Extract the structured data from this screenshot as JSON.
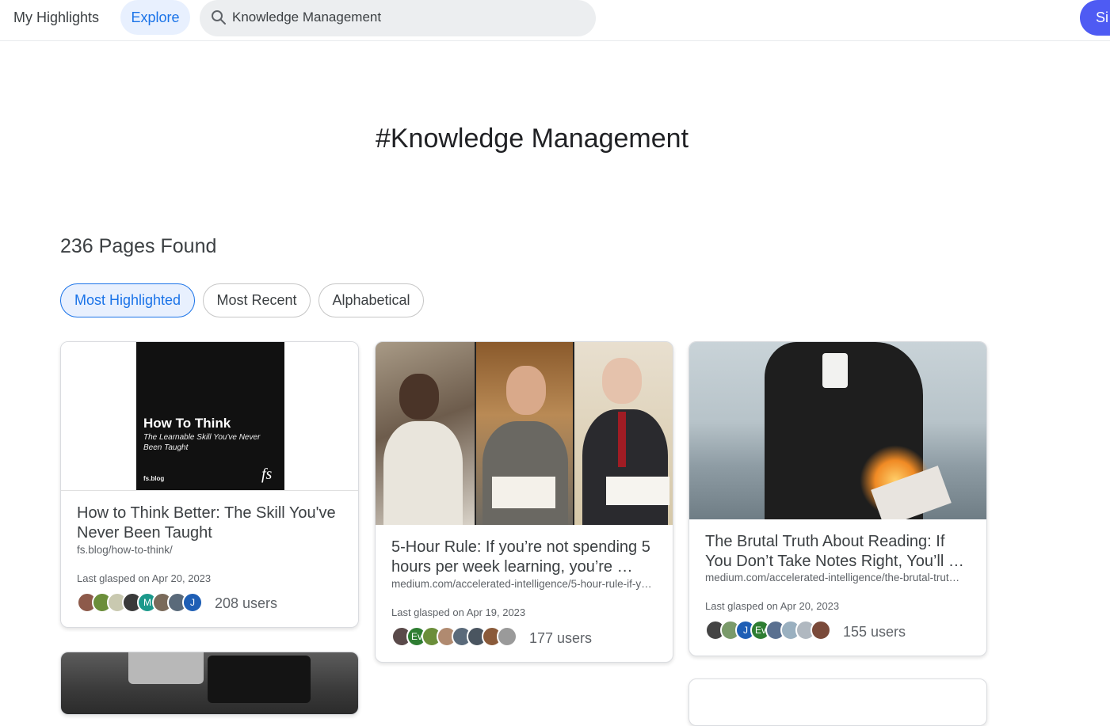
{
  "nav": {
    "my_highlights": "My Highlights",
    "explore": "Explore"
  },
  "search": {
    "value": "Knowledge Management"
  },
  "signin": {
    "label": "Si"
  },
  "page": {
    "hashtag_title": "#Knowledge Management",
    "count": "236 Pages Found"
  },
  "sort": {
    "most_highlighted": "Most Highlighted",
    "most_recent": "Most Recent",
    "alphabetical": "Alphabetical"
  },
  "cards": [
    {
      "thumb_title": "How To Think",
      "thumb_subtitle": "The Learnable Skill You've Never Been Taught",
      "thumb_site": "fs.blog",
      "thumb_logo": "fs",
      "title": "How to Think Better: The Skill You've Never Been Taught",
      "url": "fs.blog/how-to-think/",
      "date": "Last glasped on Apr 20, 2023",
      "avatars": [
        "",
        "",
        "",
        "",
        "M",
        "",
        "",
        "J"
      ],
      "users": "208 users"
    },
    {
      "title": "5-Hour Rule: If you’re not spending 5 hours per week learning, you’re …",
      "url": "medium.com/accelerated-intelligence/5-hour-rule-if-y…",
      "date": "Last glasped on Apr 19, 2023",
      "avatars": [
        "",
        "Ev",
        "",
        "",
        "",
        "",
        "",
        ""
      ],
      "users": "177 users"
    },
    {
      "title": "The Brutal Truth About Reading: If You Don’t Take Notes Right, You’ll …",
      "url": "medium.com/accelerated-intelligence/the-brutal-trut…",
      "date": "Last glasped on Apr 20, 2023",
      "avatars": [
        "",
        "",
        "J",
        "Ev",
        "",
        "",
        "",
        ""
      ],
      "users": "155 users"
    }
  ],
  "colors": {
    "accent": "#1a73e8",
    "signin": "#4e5bf3",
    "explore_bg": "#e8f0fe"
  }
}
